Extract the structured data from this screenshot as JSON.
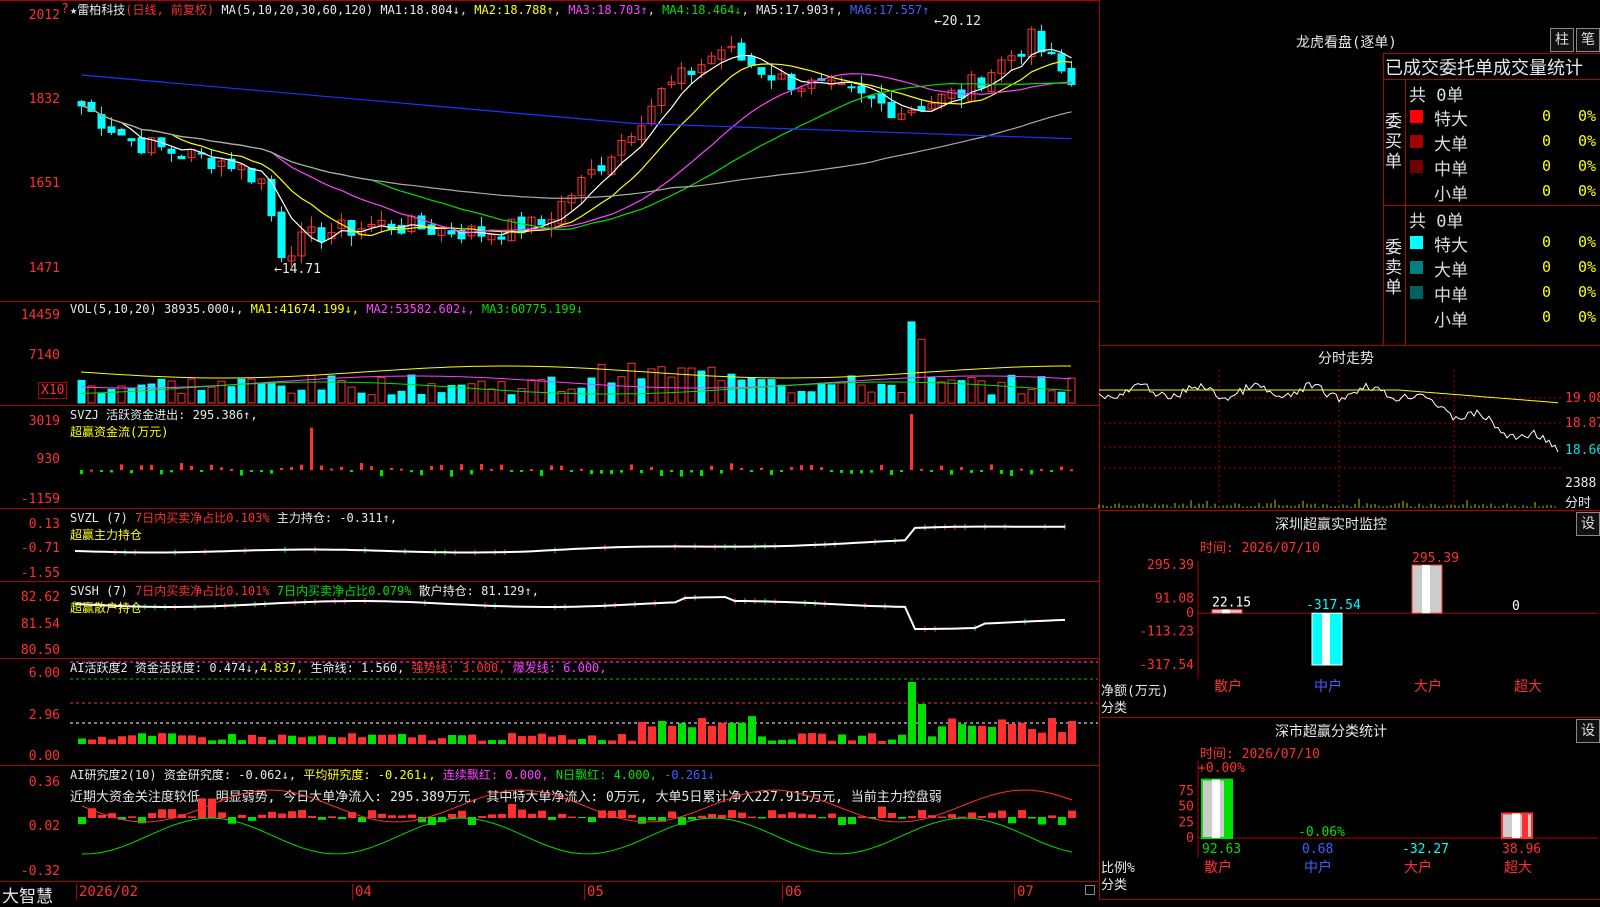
{
  "colors": {
    "up": "#ff3030",
    "down": "#00ffff",
    "border": "#b00000",
    "ma1": "#ffffff",
    "ma2": "#ffff00",
    "ma3": "#ff40ff",
    "ma4": "#00e000",
    "ma5": "#aaaaaa",
    "ma6": "#2030ff"
  },
  "main": {
    "title": "雷柏科技",
    "mode": "(日线, 前复权)",
    "ma_label": "MA(5,10,20,30,60,120)",
    "ma": [
      {
        "k": "MA1:",
        "v": "18.804↓"
      },
      {
        "k": "MA2:",
        "v": "18.788↑"
      },
      {
        "k": "MA3:",
        "v": "18.703↑"
      },
      {
        "k": "MA4:",
        "v": "18.464↓"
      },
      {
        "k": "MA5:",
        "v": "17.903↑"
      },
      {
        "k": "MA6:",
        "v": "17.557↑"
      }
    ],
    "y_labels": [
      "2012",
      "1832",
      "1651",
      "1471"
    ],
    "high_label": "20.12",
    "low_label": "14.71",
    "corner_btn": "?"
  },
  "vol": {
    "label": "VOL(5,10,20)",
    "value": "38935.000↓,",
    "ma": [
      {
        "k": "MA1:",
        "v": "41674.199↓,"
      },
      {
        "k": "MA2:",
        "v": "53582.602↓,"
      },
      {
        "k": "MA3:",
        "v": "60775.199↓"
      }
    ],
    "y_labels": [
      "14459",
      "7140"
    ],
    "unit": "X10"
  },
  "svzj": {
    "name": "SVZJ",
    "k": "活跃资金进出:",
    "v": "295.386↑,",
    "sub": "超赢资金流(万元)",
    "y_labels": [
      "3019",
      "930",
      "-1159"
    ]
  },
  "svzl": {
    "name": "SVZL (7)",
    "k1": "7日内买卖净占比0.103%",
    "k2": "主力持仓:",
    "v": "-0.311↑,",
    "sub": "超赢主力持仓",
    "y_labels": [
      "0.13",
      "-0.71",
      "-1.55"
    ]
  },
  "svsh": {
    "name": "SVSH (7)",
    "k1": "7日内买卖净占比0.101%",
    "k2": "7日内买卖净占比0.079%",
    "k3": "散户持仓:",
    "v": "81.129↑,",
    "sub": "超赢散户持仓",
    "y_labels": [
      "82.62",
      "81.54",
      "80.50"
    ]
  },
  "aihy": {
    "name": "AI活跃度2",
    "k1": "资金活跃度:",
    "v1": "0.474↓,",
    "v1b": "4.837,",
    "k2": "生命线:",
    "v2": "1.560,",
    "k3": "强势线:",
    "v3": "3.000,",
    "k4": "爆发线:",
    "v4": "6.000,",
    "y_labels": [
      "6.00",
      "2.96",
      "0.00"
    ]
  },
  "aiyj": {
    "name": "AI研究度2(10)",
    "k1": "资金研究度:",
    "v1": "-0.062↓,",
    "k2": "平均研究度:",
    "v2": "-0.261↓,",
    "k3": "连续飘红:",
    "v3": "0.000,",
    "k4": "N日飘红:",
    "v4": "4.000,",
    "v5": "-0.261↓",
    "comment": "近期大资金关注度较低, 明显弱势, 今日大单净流入: 295.389万元, 其中特大单净流入: 0万元, 大单5日累计净入227.915万元, 当前主力控盘弱",
    "y_labels": [
      "0.36",
      "0.02",
      "-0.32"
    ]
  },
  "date_axis": [
    "2026/02",
    "04",
    "05",
    "06",
    "07"
  ],
  "footer_brand": "大智慧",
  "lhb": {
    "title": "龙虎看盘(逐单)",
    "btn1": "柱",
    "btn2": "笔",
    "header": "已成交委托单成交量统计",
    "buy": {
      "side": "委买单",
      "total": "共 0单",
      "rows": [
        {
          "label": "特大",
          "color": "#ff0000",
          "count": "0",
          "pct": "0%"
        },
        {
          "label": "大单",
          "color": "#a00000",
          "count": "0",
          "pct": "0%"
        },
        {
          "label": "中单",
          "color": "#700000",
          "count": "0",
          "pct": "0%"
        },
        {
          "label": "小单",
          "color": "",
          "count": "0",
          "pct": "0%"
        }
      ]
    },
    "sell": {
      "side": "委卖单",
      "total": "共 0单",
      "rows": [
        {
          "label": "特大",
          "color": "#00ffff",
          "count": "0",
          "pct": "0%"
        },
        {
          "label": "大单",
          "color": "#008080",
          "count": "0",
          "pct": "0%"
        },
        {
          "label": "中单",
          "color": "#006060",
          "count": "0",
          "pct": "0%"
        },
        {
          "label": "小单",
          "color": "",
          "count": "0",
          "pct": "0%"
        }
      ]
    }
  },
  "fenshi": {
    "title": "分时走势",
    "y_labels": [
      "19.08",
      "18.87",
      "18.66"
    ],
    "vol_label": "2388",
    "vol_unit": "分时"
  },
  "szjk": {
    "title": "深圳超赢实时监控",
    "btn": "设",
    "time": "时间: 2026/07/10",
    "y_labels": [
      "295.39",
      "91.08",
      "0",
      "-113.23",
      "-317.54"
    ],
    "left_labels": [
      "净额(万元)",
      "分类"
    ],
    "bars": [
      {
        "cat": "散户",
        "value": 22.15,
        "label": "22.15"
      },
      {
        "cat": "中户",
        "value": -317.54,
        "label": "-317.54"
      },
      {
        "cat": "大户",
        "value": 295.39,
        "label": "295.39"
      },
      {
        "cat": "超大",
        "value": 0,
        "label": "0"
      }
    ]
  },
  "szfl": {
    "title": "深市超赢分类统计",
    "btn": "设",
    "time": "时间: 2026/07/10",
    "y_labels": [
      "75",
      "50",
      "25",
      "0"
    ],
    "left_labels": [
      "比例%",
      "分类"
    ],
    "top_labels": [
      "+0.00%",
      "-0.06%"
    ],
    "bars": [
      {
        "cat": "散户",
        "value": 92.63,
        "label": "92.63"
      },
      {
        "cat": "中户",
        "value": 0.68,
        "label": "0.68"
      },
      {
        "cat": "大户",
        "value": -32.27,
        "label": "-32.27"
      },
      {
        "cat": "超大",
        "value": 38.96,
        "label": "38.96"
      }
    ]
  }
}
